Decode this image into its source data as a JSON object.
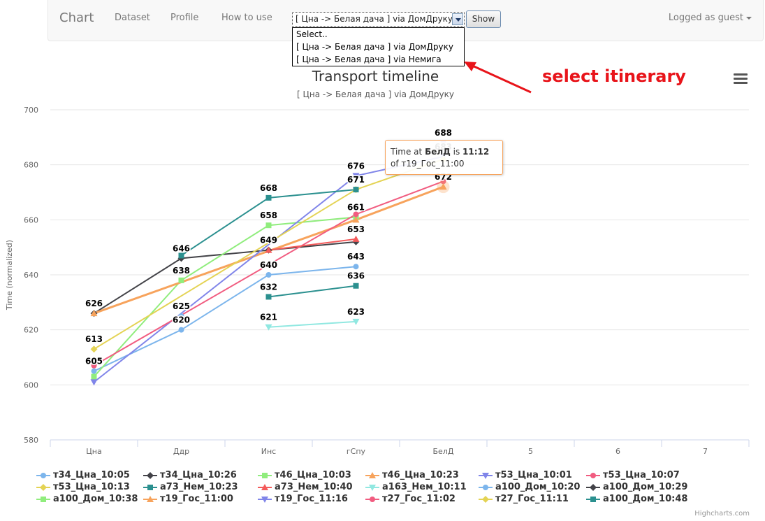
{
  "nav": {
    "brand": "Chart",
    "links": [
      "Dataset",
      "Profile",
      "How to use"
    ],
    "user_label": "Logged as guest",
    "select_value": "[ Цна -> Белая дача ] via ДомДруку",
    "select_options": [
      "Select..",
      "[ Цна -> Белая дача ] via ДомДруку",
      "[ Цна -> Белая дача ] via Немига"
    ],
    "show_button": "Show"
  },
  "annotation": {
    "text": "select itinerary",
    "color": "#e8141a"
  },
  "tooltip": {
    "line1_prefix": "Time at ",
    "stop": "БелД",
    "line1_mid": " is ",
    "time": "11:12",
    "line2": "of т19_Гос_11:00"
  },
  "credits": "Highcharts.com",
  "chart_data": {
    "type": "line",
    "title": "Transport timeline",
    "subtitle": "[ Цна -> Белая дача ] via ДомДруку",
    "ylabel": "Time (normalized)",
    "xlabel": "",
    "categories": [
      "Цна",
      "Ддр",
      "Инс",
      "гСпу",
      "БелД",
      "5",
      "6",
      "7"
    ],
    "ylim": [
      580,
      700
    ],
    "yticks": [
      580,
      600,
      620,
      640,
      660,
      680,
      700
    ],
    "grid": true,
    "legend_position": "bottom",
    "series": [
      {
        "name": "т34_Цна_10:05",
        "color": "#7cb5ec",
        "marker": "circle",
        "values": [
          605,
          620,
          640,
          643,
          null,
          null,
          null,
          null
        ]
      },
      {
        "name": "т34_Цна_10:26",
        "color": "#434348",
        "marker": "diamond",
        "values": [
          626,
          646,
          649,
          652,
          null,
          null,
          null,
          null
        ]
      },
      {
        "name": "т46_Цна_10:03",
        "color": "#90ed7d",
        "marker": "square",
        "values": [
          603,
          638,
          658,
          661,
          null,
          null,
          null,
          null
        ]
      },
      {
        "name": "т46_Цна_10:23",
        "color": "#f7a35c",
        "marker": "triangle",
        "values": [
          626,
          null,
          null,
          660,
          672,
          null,
          null,
          null
        ]
      },
      {
        "name": "т53_Цна_10:01",
        "color": "#8085e9",
        "marker": "triangle-down",
        "values": [
          601,
          null,
          null,
          676,
          683,
          null,
          null,
          null
        ]
      },
      {
        "name": "т53_Цна_10:07",
        "color": "#f15c80",
        "marker": "circle",
        "values": [
          607,
          null,
          null,
          662,
          674,
          null,
          null,
          null
        ]
      },
      {
        "name": "т53_Цна_10:13",
        "color": "#e4d354",
        "marker": "diamond",
        "values": [
          613,
          null,
          null,
          671,
          682,
          null,
          null,
          null
        ]
      },
      {
        "name": "а73_Нем_10:23",
        "color": "#2b908f",
        "marker": "square",
        "values": [
          null,
          null,
          632,
          636,
          null,
          null,
          null,
          null
        ]
      },
      {
        "name": "а73_Нем_10:40",
        "color": "#f45b5b",
        "marker": "triangle",
        "values": [
          null,
          null,
          649,
          653,
          null,
          null,
          null,
          null
        ]
      },
      {
        "name": "а163_Нем_10:11",
        "color": "#91e8e1",
        "marker": "triangle-down",
        "values": [
          null,
          null,
          621,
          623,
          null,
          null,
          null,
          null
        ]
      },
      {
        "name": "а100_Дом_10:20",
        "color": "#7cb5ec",
        "marker": "circle",
        "values": [
          null,
          625,
          null,
          null,
          null,
          null,
          null,
          null
        ]
      },
      {
        "name": "а100_Дом_10:29",
        "color": "#434348",
        "marker": "diamond",
        "values": [
          null,
          null,
          null,
          null,
          null,
          null,
          null,
          null
        ]
      },
      {
        "name": "а100_Дом_10:38",
        "color": "#90ed7d",
        "marker": "square",
        "values": [
          null,
          null,
          null,
          null,
          null,
          null,
          null,
          null
        ]
      },
      {
        "name": "т19_Гос_11:00",
        "color": "#f7a35c",
        "marker": "triangle",
        "values": [
          null,
          null,
          null,
          null,
          672,
          null,
          null,
          null
        ]
      },
      {
        "name": "т19_Гос_11:16",
        "color": "#8085e9",
        "marker": "triangle-down",
        "values": [
          null,
          null,
          null,
          null,
          688,
          null,
          null,
          null
        ]
      },
      {
        "name": "т27_Гос_11:02",
        "color": "#f15c80",
        "marker": "circle",
        "values": [
          null,
          null,
          null,
          null,
          null,
          null,
          null,
          null
        ]
      },
      {
        "name": "т27_Гос_11:11",
        "color": "#e4d354",
        "marker": "diamond",
        "values": [
          null,
          null,
          null,
          null,
          null,
          null,
          null,
          null
        ]
      },
      {
        "name": "а100_Дом_10:48",
        "color": "#2b908f",
        "marker": "square",
        "values": [
          null,
          647,
          668,
          671,
          null,
          null,
          null,
          null
        ]
      }
    ],
    "data_labels": [
      {
        "x": "Цна",
        "y": 626,
        "text": "626"
      },
      {
        "x": "Цна",
        "y": 613,
        "text": "613"
      },
      {
        "x": "Цна",
        "y": 605,
        "text": "605"
      },
      {
        "x": "Ддр",
        "y": 646,
        "text": "646"
      },
      {
        "x": "Ддр",
        "y": 638,
        "text": "638"
      },
      {
        "x": "Ддр",
        "y": 625,
        "text": "625"
      },
      {
        "x": "Ддр",
        "y": 620,
        "text": "620"
      },
      {
        "x": "Инс",
        "y": 668,
        "text": "668"
      },
      {
        "x": "Инс",
        "y": 658,
        "text": "658"
      },
      {
        "x": "Инс",
        "y": 649,
        "text": "649"
      },
      {
        "x": "Инс",
        "y": 640,
        "text": "640"
      },
      {
        "x": "Инс",
        "y": 632,
        "text": "632"
      },
      {
        "x": "Инс",
        "y": 621,
        "text": "621"
      },
      {
        "x": "гСпу",
        "y": 676,
        "text": "676"
      },
      {
        "x": "гСпу",
        "y": 671,
        "text": "671"
      },
      {
        "x": "гСпу",
        "y": 661,
        "text": "661"
      },
      {
        "x": "гСпу",
        "y": 653,
        "text": "653"
      },
      {
        "x": "гСпу",
        "y": 643,
        "text": "643"
      },
      {
        "x": "гСпу",
        "y": 636,
        "text": "636"
      },
      {
        "x": "гСпу",
        "y": 623,
        "text": "623"
      },
      {
        "x": "БелД",
        "y": 688,
        "text": "688"
      },
      {
        "x": "БелД",
        "y": 683,
        "text": "683"
      },
      {
        "x": "БелД",
        "y": 672,
        "text": "672"
      }
    ]
  }
}
